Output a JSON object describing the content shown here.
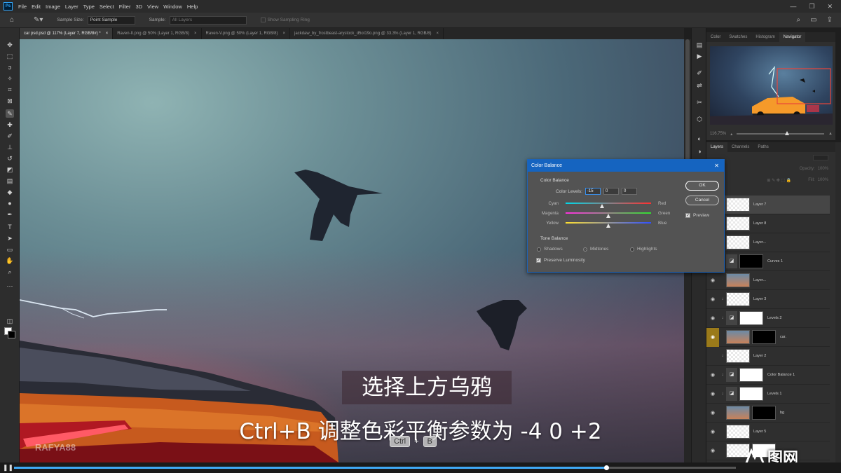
{
  "app": {
    "menus": [
      "File",
      "Edit",
      "Image",
      "Layer",
      "Type",
      "Select",
      "Filter",
      "3D",
      "View",
      "Window",
      "Help"
    ],
    "window_buttons": [
      "—",
      "❐",
      "✕"
    ]
  },
  "options": {
    "sample_size_label": "Sample Size:",
    "sample_size_value": "Point Sample",
    "sample_label": "Sample:",
    "sample_value": "All Layers",
    "show_ring_label": "Show Sampling Ring"
  },
  "tabs": [
    {
      "label": "car psd.psd @ 117% (Layer 7, RGB/8#) *",
      "active": true
    },
    {
      "label": "Raven-II.png @ 50% (Layer 1, RGB/8)",
      "active": false
    },
    {
      "label": "Raven-V.png @ 50% (Layer 1, RGB/8)",
      "active": false
    },
    {
      "label": "jackdaw_by_frostbeast-arystock_d5ot19o.png @ 33.3% (Layer 1, RGB/8)",
      "active": false
    }
  ],
  "navigator": {
    "tabs": [
      "Color",
      "Swatches",
      "Histogram",
      "Navigator"
    ],
    "active_tab": "Navigator",
    "zoom": "116.75%"
  },
  "layers": {
    "tabs": [
      "Layers",
      "Channels",
      "Paths"
    ],
    "active_tab": "Layers",
    "opacity_label": "Opacity:",
    "opacity_value": "100%",
    "fill_label": "Fill:",
    "fill_value": "100%",
    "items": [
      {
        "name": "Layer 7",
        "thumb": "trans",
        "selected": true,
        "visible": false,
        "clipped": false
      },
      {
        "name": "Layer 8",
        "thumb": "trans",
        "selected": false,
        "visible": false,
        "clipped": true
      },
      {
        "name": "Layer...",
        "thumb": "trans",
        "selected": false,
        "visible": false,
        "clipped": false
      },
      {
        "name": "Curves 1",
        "thumb": "adj",
        "mask": "dark",
        "selected": false,
        "visible": false,
        "clipped": true
      },
      {
        "name": "Layer...",
        "thumb": "photo",
        "selected": false,
        "visible": true,
        "clipped": false
      },
      {
        "name": "Layer 3",
        "thumb": "trans",
        "selected": false,
        "visible": true,
        "clipped": true
      },
      {
        "name": "Levels 2",
        "thumb": "adj",
        "mask": "light",
        "selected": false,
        "visible": true,
        "clipped": true
      },
      {
        "name": "car.",
        "thumb": "photo",
        "mask": "dark",
        "selected": false,
        "visible": true,
        "clipped": false,
        "highlight": true
      },
      {
        "name": "Layer 2",
        "thumb": "trans",
        "selected": false,
        "visible": false,
        "clipped": true
      },
      {
        "name": "Color Balance 1",
        "thumb": "adj",
        "mask": "light",
        "selected": false,
        "visible": true,
        "clipped": true
      },
      {
        "name": "Levels 1",
        "thumb": "adj",
        "mask": "light",
        "selected": false,
        "visible": true,
        "clipped": true
      },
      {
        "name": "bg",
        "thumb": "photo",
        "mask": "dark",
        "selected": false,
        "visible": true,
        "clipped": false
      },
      {
        "name": "Layer 5",
        "thumb": "trans",
        "selected": false,
        "visible": true,
        "clipped": false
      },
      {
        "name": "",
        "thumb": "trans",
        "mask": "light",
        "selected": false,
        "visible": true,
        "clipped": false
      }
    ]
  },
  "dialog": {
    "title": "Color Balance",
    "section_color": "Color Balance",
    "levels_label": "Color Levels:",
    "levels": [
      "-15",
      "0",
      "0"
    ],
    "sliders": [
      {
        "left": "Cyan",
        "right": "Red",
        "value": -15
      },
      {
        "left": "Magenta",
        "right": "Green",
        "value": 0
      },
      {
        "left": "Yellow",
        "right": "Blue",
        "value": 0
      }
    ],
    "section_tone": "Tone Balance",
    "tones": [
      "Shadows",
      "Midtones",
      "Highlights"
    ],
    "tone_selected": "Midtones",
    "preserve_label": "Preserve Luminosity",
    "preserve_checked": true,
    "ok_label": "OK",
    "cancel_label": "Cancel",
    "preview_label": "Preview",
    "preview_checked": true
  },
  "subtitles": {
    "line1": "选择上方乌鸦",
    "line2": "Ctrl+B 调整色彩平衡参数为 -4 0 +2"
  },
  "keys": {
    "k1": "Ctrl",
    "plus": "+",
    "k2": "B"
  },
  "watermark": "RAFYA88",
  "logo_text": "图网",
  "player": {
    "progress": 0.82
  }
}
